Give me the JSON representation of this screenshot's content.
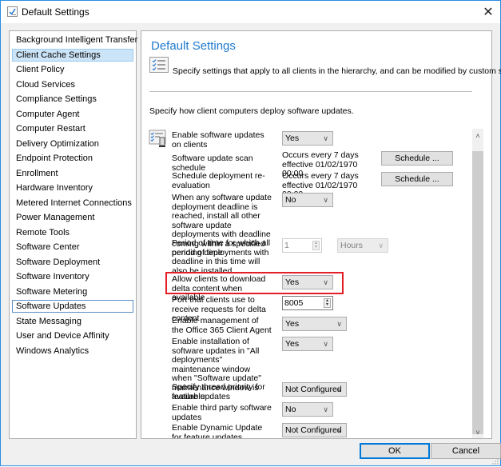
{
  "window": {
    "title": "Default Settings",
    "close_glyph": "✕"
  },
  "nav": {
    "items": [
      {
        "label": "Background Intelligent Transfer",
        "state": "normal"
      },
      {
        "label": "Client Cache Settings",
        "state": "selected"
      },
      {
        "label": "Client Policy",
        "state": "normal"
      },
      {
        "label": "Cloud Services",
        "state": "normal"
      },
      {
        "label": "Compliance Settings",
        "state": "normal"
      },
      {
        "label": "Computer Agent",
        "state": "normal"
      },
      {
        "label": "Computer Restart",
        "state": "normal"
      },
      {
        "label": "Delivery Optimization",
        "state": "normal"
      },
      {
        "label": "Endpoint Protection",
        "state": "normal"
      },
      {
        "label": "Enrollment",
        "state": "normal"
      },
      {
        "label": "Hardware Inventory",
        "state": "normal"
      },
      {
        "label": "Metered Internet Connections",
        "state": "normal"
      },
      {
        "label": "Power Management",
        "state": "normal"
      },
      {
        "label": "Remote Tools",
        "state": "normal"
      },
      {
        "label": "Software Center",
        "state": "normal"
      },
      {
        "label": "Software Deployment",
        "state": "normal"
      },
      {
        "label": "Software Inventory",
        "state": "normal"
      },
      {
        "label": "Software Metering",
        "state": "normal"
      },
      {
        "label": "Software Updates",
        "state": "focused"
      },
      {
        "label": "State Messaging",
        "state": "normal"
      },
      {
        "label": "User and Device Affinity",
        "state": "normal"
      },
      {
        "label": "Windows Analytics",
        "state": "normal"
      }
    ]
  },
  "panel": {
    "title": "Default Settings",
    "header_icon": "checklist-icon",
    "header_description": "Specify settings that apply to all clients in the hierarchy, and can be modified by custom settings.",
    "section_description": "Specify how client computers deploy software updates.",
    "section_icon": "software-updates-settings-icon",
    "settings": {
      "enable_updates": {
        "label": "Enable software updates on clients",
        "value": "Yes"
      },
      "scan_schedule": {
        "label": "Software update scan schedule",
        "value": "Occurs every 7 days effective 01/02/1970 00:00",
        "button": "Schedule ..."
      },
      "reevaluation": {
        "label": "Schedule deployment re-evaluation",
        "value": "Occurs every 7 days effective 01/02/1970 00:00",
        "button": "Schedule ..."
      },
      "deadline_install": {
        "label": "When any software update deployment deadline is reached, install all other software update deployments with deadline coming within a specified period of time",
        "value": "No"
      },
      "period": {
        "label": "Period of time for which all pending deployments with deadline in this time will also be installed",
        "value": "1",
        "unit": "Hours"
      },
      "delta_content": {
        "label": "Allow clients to download delta content when available",
        "value": "Yes",
        "highlighted": true
      },
      "delta_port": {
        "label": "Port that clients use to receive requests for delta content",
        "value": "8005"
      },
      "office365": {
        "label": "Enable management of the Office 365 Client Agent",
        "value": "Yes"
      },
      "maintenance_window": {
        "label": "Enable installation of software updates in \"All deployments\" maintenance window when \"Software update\" maintenance window is available",
        "value": "Yes"
      },
      "thread_priority": {
        "label": "Specify thread priority for feature updates",
        "value": "Not Configured"
      },
      "third_party": {
        "label": "Enable third party software updates",
        "value": "No"
      },
      "dynamic_update": {
        "label": "Enable Dynamic Update for feature updates",
        "value": "Not Configured"
      }
    }
  },
  "footer": {
    "ok_label": "OK",
    "cancel_label": "Cancel"
  },
  "glyphs": {
    "chevron_down": "∨",
    "scroll_up": "˄",
    "scroll_down": "˅",
    "spin_up": "▲",
    "spin_down": "▼"
  },
  "colors": {
    "accent": "#1e7acd",
    "selection": "#cce4f7",
    "highlight_border": "#e41e26",
    "window_border": "#2b8ee0"
  }
}
